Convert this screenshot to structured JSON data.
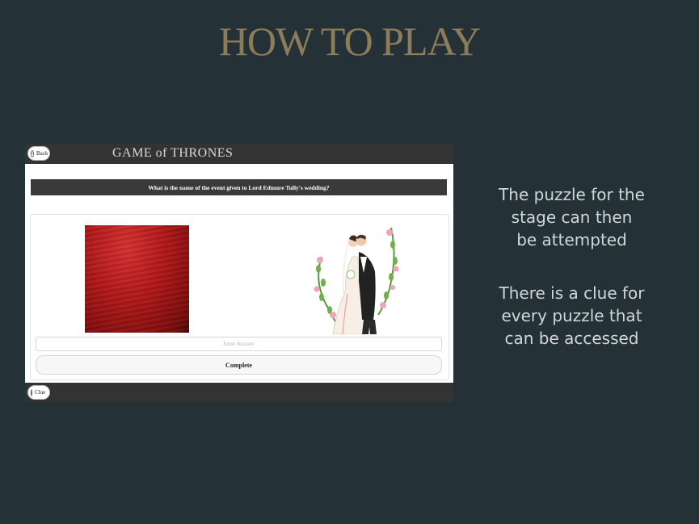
{
  "slide": {
    "title": "HOW TO PLAY",
    "description_1": "The puzzle for the\nstage can then\nbe attempted",
    "description_2": "There is a clue for\nevery puzzle that\ncan be accessed"
  },
  "app": {
    "header": {
      "back_label": "Back",
      "logo_text": "GAME of THRONES"
    },
    "question": "What is the name of the event given to Lord Edmure Tully's wedding?",
    "images": {
      "clue_image_1": "red-water",
      "clue_image_2": "wedding-couple"
    },
    "answer": {
      "placeholder": "Enter Answer",
      "value": ""
    },
    "complete_label": "Complete",
    "footer": {
      "clue_label": "Clue"
    }
  },
  "colors": {
    "background": "#243238",
    "title": "#8c7c5a",
    "app_bar": "#333333",
    "question_bar": "#3a3a3a",
    "sea_red": "#b01818"
  }
}
